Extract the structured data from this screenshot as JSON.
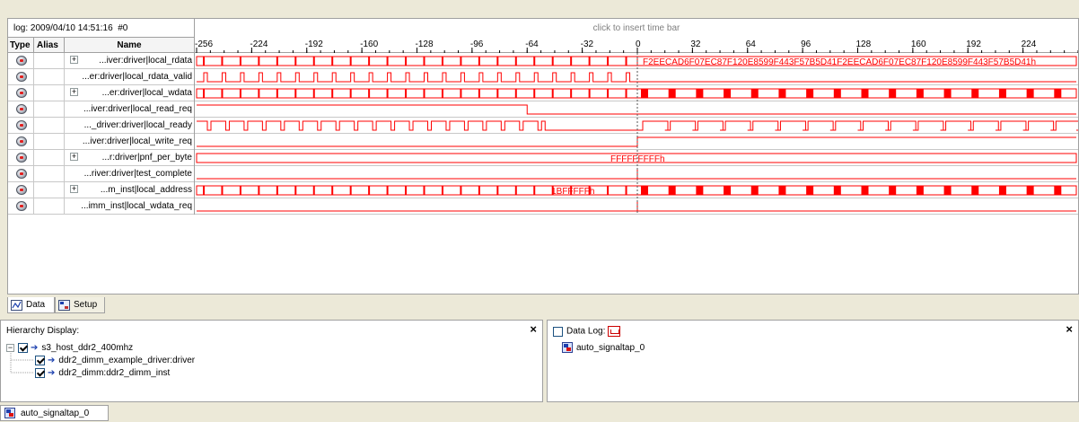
{
  "viewer": {
    "log_label": "log: 2009/04/10 14:51:16  #0",
    "insert_bar_label": "click to insert time bar",
    "columns": {
      "type": "Type",
      "alias": "Alias",
      "name": "Name"
    },
    "time_axis": {
      "ticks": [
        -256,
        -224,
        -192,
        -160,
        -128,
        -96,
        -64,
        -32,
        0,
        32,
        64,
        96,
        128,
        160,
        192,
        224
      ],
      "range": [
        -256,
        256
      ],
      "trigger_time": 0
    },
    "waveform_color": "#ff0000",
    "signals": [
      {
        "name": "...iver:driver|local_rdata",
        "expandable": true,
        "kind": "bus_pulse",
        "value_label": "F2EECAD6F07EC87F120E8599F443F57B5D41F2EECAD6F07EC87F120E8599F443F57B5D41h"
      },
      {
        "name": "...er:driver|local_rdata_valid",
        "expandable": false,
        "kind": "pulse_before"
      },
      {
        "name": "...er:driver|local_wdata",
        "expandable": true,
        "kind": "bus_pulse_blocks"
      },
      {
        "name": "...iver:driver|local_read_req",
        "expandable": false,
        "kind": "high_then_low",
        "switch_time": -64
      },
      {
        "name": "..._driver:driver|local_ready",
        "expandable": false,
        "kind": "ready"
      },
      {
        "name": "...iver:driver|local_write_req",
        "expandable": false,
        "kind": "low_then_high",
        "switch_time": 0
      },
      {
        "name": "...r:driver|pnf_per_byte",
        "expandable": true,
        "kind": "bus_const",
        "value_label": "FFFFFFFFFh"
      },
      {
        "name": "...river:driver|test_complete",
        "expandable": false,
        "kind": "low"
      },
      {
        "name": "...m_inst|local_address",
        "expandable": true,
        "kind": "bus_pulse_blocks",
        "value_label": "1BFFFFFh"
      },
      {
        "name": "...imm_inst|local_wdata_req",
        "expandable": false,
        "kind": "low"
      }
    ]
  },
  "tabs": [
    {
      "label": "Data",
      "icon": "data-icon"
    },
    {
      "label": "Setup",
      "icon": "setup-icon"
    }
  ],
  "hierarchy": {
    "title": "Hierarchy Display:",
    "items": [
      {
        "label": "s3_host_ddr2_400mhz",
        "level": 0
      },
      {
        "label": "ddr2_dimm_example_driver:driver",
        "level": 1
      },
      {
        "label": "ddr2_dimm:ddr2_dimm_inst",
        "level": 1
      }
    ]
  },
  "datalog": {
    "title": "Data Log:",
    "instance": "auto_signaltap_0"
  },
  "status_tab": {
    "label": "auto_signaltap_0"
  }
}
